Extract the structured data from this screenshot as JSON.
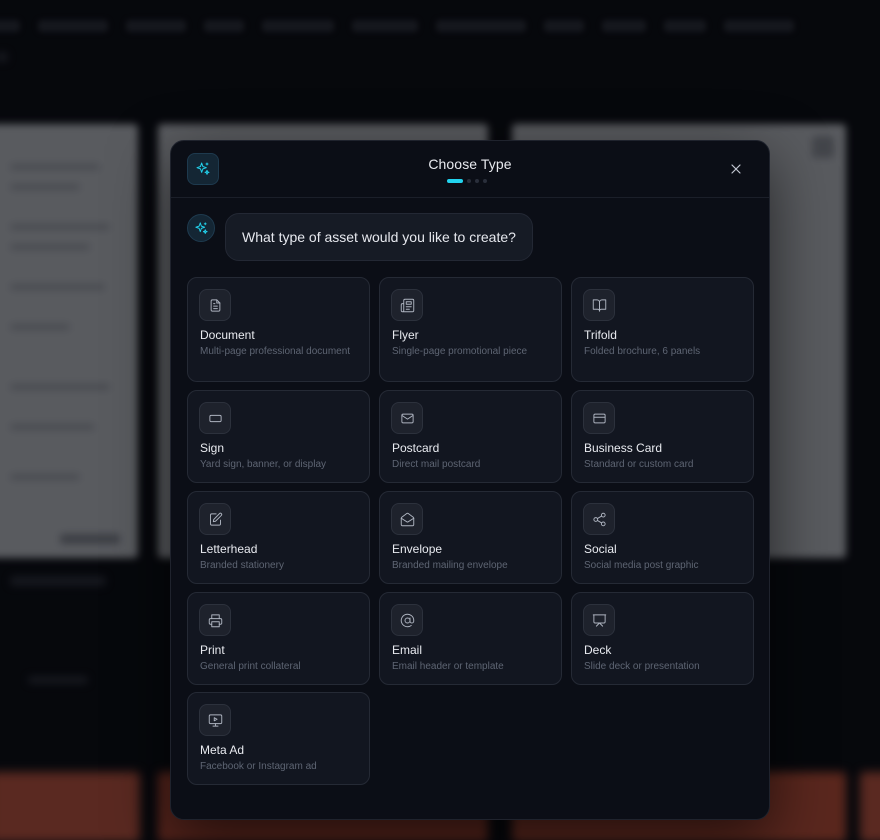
{
  "modal": {
    "title": "Choose Type",
    "step_current": 1,
    "step_total": 4,
    "assistant_message": "What type of asset would you like to create?",
    "accent": "#22d3ee"
  },
  "types": [
    {
      "label": "Document",
      "desc": "Multi-page professional document",
      "icon": "document-icon"
    },
    {
      "label": "Flyer",
      "desc": "Single-page promotional piece",
      "icon": "newspaper-icon"
    },
    {
      "label": "Trifold",
      "desc": "Folded brochure, 6 panels",
      "icon": "book-open-icon"
    },
    {
      "label": "Sign",
      "desc": "Yard sign, banner, or display",
      "icon": "rectangle-icon"
    },
    {
      "label": "Postcard",
      "desc": "Direct mail postcard",
      "icon": "mail-icon"
    },
    {
      "label": "Business Card",
      "desc": "Standard or custom card",
      "icon": "credit-card-icon"
    },
    {
      "label": "Letterhead",
      "desc": "Branded stationery",
      "icon": "file-edit-icon"
    },
    {
      "label": "Envelope",
      "desc": "Branded mailing envelope",
      "icon": "mail-open-icon"
    },
    {
      "label": "Social",
      "desc": "Social media post graphic",
      "icon": "share-icon"
    },
    {
      "label": "Print",
      "desc": "General print collateral",
      "icon": "printer-icon"
    },
    {
      "label": "Email",
      "desc": "Email header or template",
      "icon": "at-sign-icon"
    },
    {
      "label": "Deck",
      "desc": "Slide deck or presentation",
      "icon": "presentation-icon"
    },
    {
      "label": "Meta Ad",
      "desc": "Facebook or Instagram ad",
      "icon": "monitor-play-icon"
    }
  ]
}
